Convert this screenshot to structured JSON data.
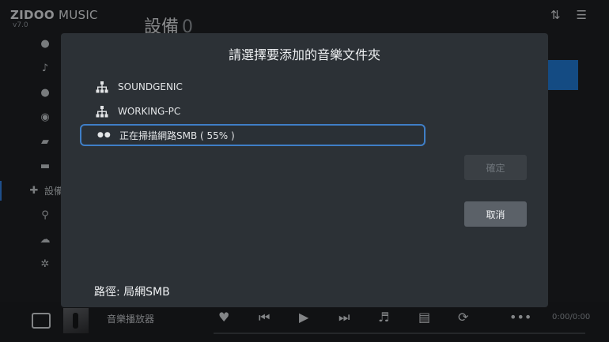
{
  "app": {
    "brand_bold": "ZIDOO",
    "brand_thin": " MUSIC",
    "version": "v7.0"
  },
  "page": {
    "title": "設備",
    "count": "0"
  },
  "sidebar": {
    "items": [
      {
        "icon": "person-icon"
      },
      {
        "icon": "music-note-icon"
      },
      {
        "icon": "artist-icon"
      },
      {
        "icon": "disc-icon"
      },
      {
        "icon": "media-folder-icon"
      },
      {
        "icon": "folder-icon"
      },
      {
        "icon": "plus-icon",
        "label": "設備"
      },
      {
        "icon": "search-icon"
      },
      {
        "icon": "cloud-icon"
      },
      {
        "icon": "settings-icon"
      }
    ]
  },
  "dialog": {
    "title": "請選擇要添加的音樂文件夾",
    "folders": [
      {
        "label": "SOUNDGENIC",
        "icon": "network-icon"
      },
      {
        "label": "WORKING-PC",
        "icon": "network-icon"
      },
      {
        "label": "正在掃描網路SMB ( 55% )",
        "icon": "loading-dots-icon",
        "scan_progress_percent": 55
      }
    ],
    "ok_label": "確定",
    "cancel_label": "取消",
    "path_label": "路徑: 局網SMB"
  },
  "player": {
    "track_title": "音樂播放器",
    "time": "0:00/0:00"
  },
  "colors": {
    "accent": "#1f73c9",
    "dialog_bg": "#2c3136",
    "selection_border": "#3f7ec6"
  }
}
